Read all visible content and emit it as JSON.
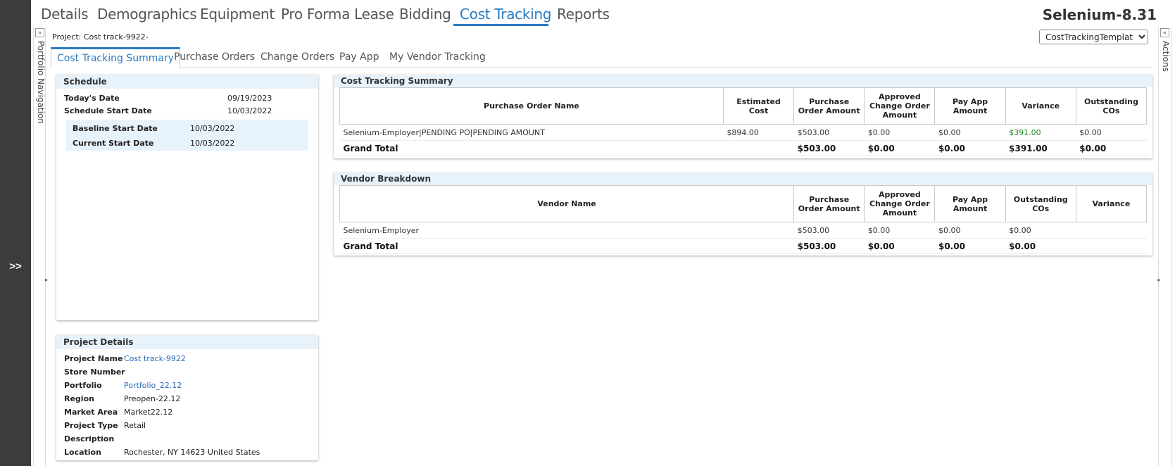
{
  "nav": {
    "tabs": [
      "Details",
      "Demographics",
      "Equipment",
      "Pro Forma Lease",
      "Bidding",
      "Cost Tracking",
      "Reports"
    ],
    "active_tab": "Cost Tracking",
    "brand": "Selenium-8.31"
  },
  "rail": {
    "expand_label": ">>"
  },
  "left_side": {
    "label": "Portfolio Navigation"
  },
  "right_side": {
    "label": "Actions"
  },
  "project_label": "Project: Cost track-9922-",
  "template_select": {
    "value": "CostTrackingTemplate",
    "options": [
      "CostTrackingTemplate"
    ]
  },
  "subtabs": [
    "Cost Tracking Summary",
    "Purchase Orders",
    "Change Orders",
    "Pay App",
    "My Vendor Tracking"
  ],
  "schedule": {
    "title": "Schedule",
    "todays_date_label": "Today's Date",
    "todays_date": "09/19/2023",
    "schedule_start_label": "Schedule Start Date",
    "schedule_start": "10/03/2022",
    "baseline_start_label": "Baseline Start Date",
    "baseline_start": "10/03/2022",
    "current_start_label": "Current Start Date",
    "current_start": "10/03/2022"
  },
  "project_details": {
    "title": "Project Details",
    "project_name_label": "Project Name",
    "project_name": "Cost track-9922",
    "store_number_label": "Store Number",
    "store_number": "",
    "portfolio_label": "Portfolio",
    "portfolio": "Portfolio_22.12",
    "region_label": "Region",
    "region": "Preopen-22.12",
    "market_area_label": "Market Area",
    "market_area": "Market22.12",
    "project_type_label": "Project Type",
    "project_type": "Retail",
    "description_label": "Description",
    "description": "",
    "location_label": "Location",
    "location": "Rochester, NY 14623 United States"
  },
  "cost_summary": {
    "title": "Cost Tracking Summary",
    "headers": [
      "Purchase Order Name",
      "Estimated Cost",
      "Purchase Order Amount",
      "Approved Change Order Amount",
      "Pay App Amount",
      "Variance",
      "Outstanding COs"
    ],
    "rows": [
      [
        "Selenium-Employer|PENDING PO|PENDING AMOUNT",
        "$894.00",
        "$503.00",
        "$0.00",
        "$0.00",
        "$391.00",
        "$0.00"
      ]
    ],
    "total": [
      "Grand Total",
      "",
      "$503.00",
      "$0.00",
      "$0.00",
      "$391.00",
      "$0.00"
    ]
  },
  "vendor_breakdown": {
    "title": "Vendor Breakdown",
    "headers": [
      "Vendor Name",
      "Purchase Order Amount",
      "Approved Change Order Amount",
      "Pay App Amount",
      "Outstanding COs",
      "Variance"
    ],
    "rows": [
      [
        "Selenium-Employer",
        "$503.00",
        "$0.00",
        "$0.00",
        "$0.00",
        ""
      ]
    ],
    "total": [
      "Grand Total",
      "$503.00",
      "$0.00",
      "$0.00",
      "$0.00",
      ""
    ]
  },
  "colors": {
    "accent": "#2a7ac0",
    "header_bg": "#e8f2fb",
    "positive": "#1e8a1e",
    "rail": "#3c3c3c"
  }
}
